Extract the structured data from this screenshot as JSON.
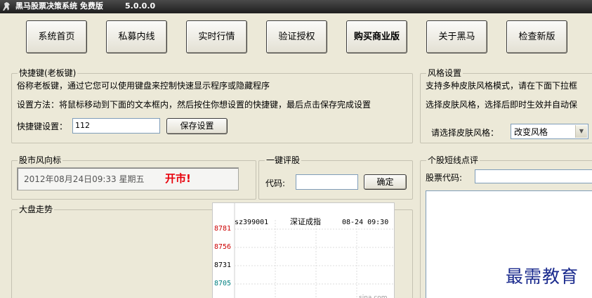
{
  "window": {
    "title": "黑马股票决策系统 免费版",
    "version": "5.0.0.0"
  },
  "nav": {
    "home": "系统首页",
    "private_fund": "私募内线",
    "realtime": "实时行情",
    "verify": "验证授权",
    "buy": "购买商业版",
    "about": "关于黑马",
    "update": "检查新版"
  },
  "hotkey": {
    "group_title": "快捷键(老板键)",
    "desc": "俗称老板键，通过它您可以使用键盘来控制快速显示程序或隐藏程序",
    "method": "设置方法：将鼠标移动到下面的文本框内，然后按住你想设置的快捷键，最后点击保存完成设置",
    "label": "快捷键设置：",
    "value": "112",
    "save_label": "保存设置"
  },
  "skin": {
    "group_title": "风格设置",
    "desc1": "支持多种皮肤风格模式，请在下面下拉框",
    "desc2": "选择皮肤风格，选择后即时生效并自动保",
    "label": "请选择皮肤风格：",
    "value": "改变风格"
  },
  "market_indicator": {
    "group_title": "股市风向标",
    "datetime": "2012年08月24日09:33  星期五",
    "status": "开市!",
    "status_color": "#e8000b"
  },
  "rating": {
    "group_title": "一键评股",
    "code_label": "代码:",
    "code_value": "",
    "confirm_label": "确定"
  },
  "short_comment": {
    "group_title": "个股短线点评",
    "code_label": "股票代码:",
    "code_value": ""
  },
  "trend": {
    "group_title": "大盘走势"
  },
  "chart_data": {
    "type": "line",
    "title": "深证成指",
    "code": "sz399001",
    "timestamp": "08-24 09:30",
    "source": "sina.com",
    "y_ticks": [
      {
        "label": "8781",
        "color": "#cc0000"
      },
      {
        "label": "8756",
        "color": "#cc0000"
      },
      {
        "label": "8731",
        "color": "#000000"
      },
      {
        "label": "8705",
        "color": "#008080"
      }
    ],
    "grid": true
  },
  "watermark": {
    "text": "最需教育"
  }
}
